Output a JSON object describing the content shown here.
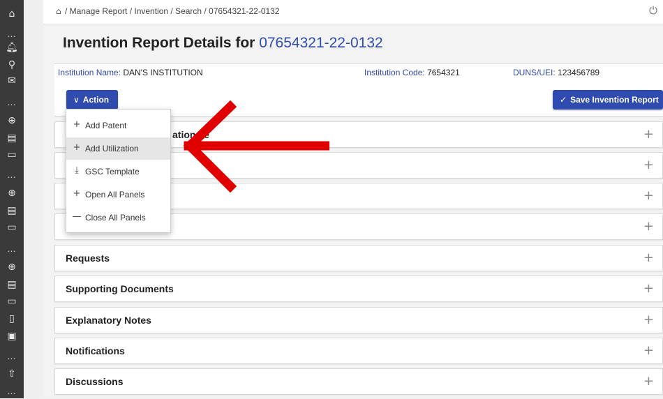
{
  "rail": {
    "icons": [
      "home-icon",
      "more-icon",
      "bell-icon",
      "search-icon",
      "mail-icon",
      "more-icon",
      "globe-icon",
      "document-icon",
      "wallet-icon",
      "more-icon",
      "globe-icon",
      "document-icon",
      "wallet-icon",
      "more-icon",
      "globe-icon",
      "document-icon",
      "wallet-icon",
      "file-icon",
      "pdf-icon",
      "more-icon",
      "upload-icon",
      "more-icon"
    ]
  },
  "breadcrumb": {
    "home_glyph": "⌂",
    "text": "/ Manage Report / Invention / Search / 07654321-22-0132"
  },
  "page": {
    "title_prefix": "Invention Report Details for ",
    "title_number": "07654321-22-0132"
  },
  "institution": {
    "name_label": "Institution Name:",
    "name_value": "DAN'S INSTITUTION",
    "code_label": "Institution Code:",
    "code_value": "7654321",
    "duns_label": "DUNS/UEI:",
    "duns_value": "123456789"
  },
  "toolbar": {
    "action_label": "Action",
    "save_label": "Save Invention Report"
  },
  "menu": {
    "items": [
      {
        "icon": "plus-icon",
        "glyph": "+",
        "label": "Add Patent"
      },
      {
        "icon": "plus-icon",
        "glyph": "+",
        "label": "Add Utilization"
      },
      {
        "icon": "download-icon",
        "glyph": "⤓",
        "label": "GSC Template"
      },
      {
        "icon": "plus-icon",
        "glyph": "+",
        "label": "Open All Panels"
      },
      {
        "icon": "minus-icon",
        "glyph": "—",
        "label": "Close All Panels"
      }
    ],
    "highlighted_index": 1
  },
  "panels": [
    {
      "title": "",
      "partial_text": "ation ee"
    },
    {
      "title": ""
    },
    {
      "title": ""
    },
    {
      "title": ""
    },
    {
      "title": "Requests"
    },
    {
      "title": "Supporting Documents"
    },
    {
      "title": "Explanatory Notes"
    },
    {
      "title": "Notifications"
    },
    {
      "title": "Discussions"
    }
  ],
  "colors": {
    "accent": "#2f4bb0",
    "rail": "#3a3a3a",
    "annotation_arrow": "#e00000"
  }
}
